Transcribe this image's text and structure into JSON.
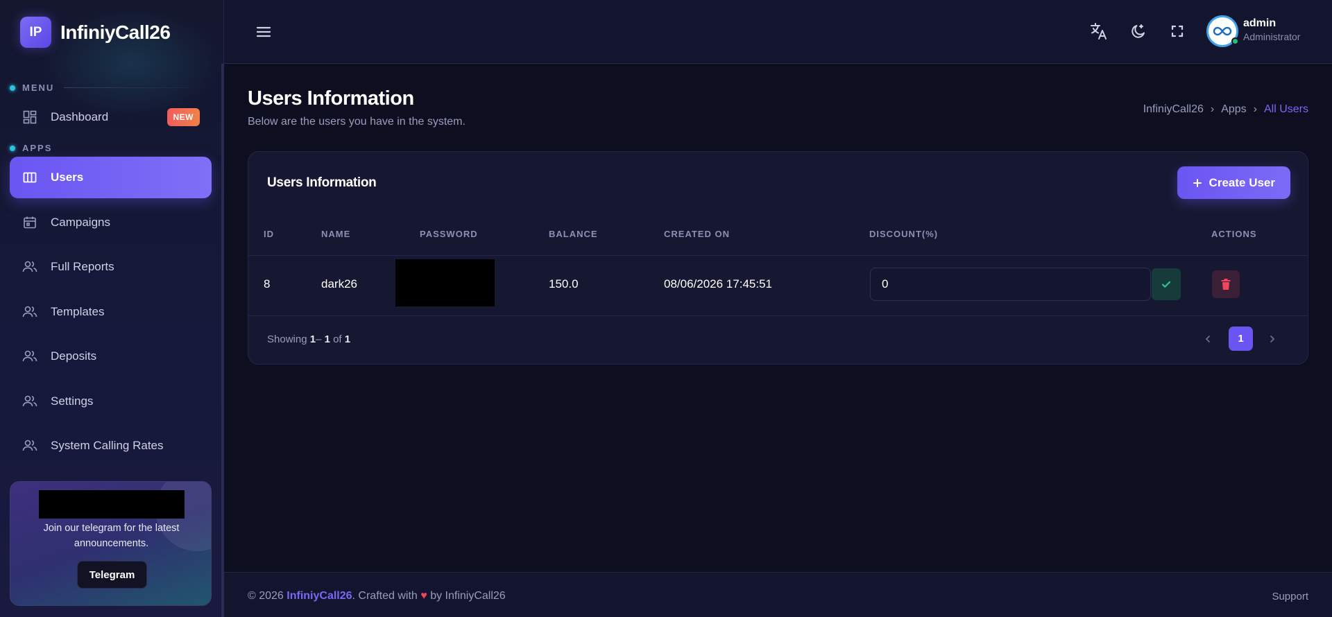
{
  "brand": {
    "logo_text": "IP",
    "name": "InfiniyCall26"
  },
  "sidebar": {
    "sections": [
      {
        "label": "MENU"
      },
      {
        "label": "APPS"
      }
    ],
    "items": [
      {
        "label": "Dashboard",
        "icon": "dashboard-icon",
        "badge": "NEW"
      },
      {
        "label": "Users",
        "icon": "table-icon",
        "active": true
      },
      {
        "label": "Campaigns",
        "icon": "calendar-icon"
      },
      {
        "label": "Full Reports",
        "icon": "users-icon"
      },
      {
        "label": "Templates",
        "icon": "users-icon"
      },
      {
        "label": "Deposits",
        "icon": "users-icon"
      },
      {
        "label": "Settings",
        "icon": "users-icon"
      },
      {
        "label": "System Calling Rates",
        "icon": "users-icon"
      }
    ],
    "promo": {
      "text": "Join our telegram for the latest announcements.",
      "button_label": "Telegram"
    }
  },
  "topbar": {
    "icons": [
      "menu-icon",
      "translate-icon",
      "moon-icon",
      "fullscreen-icon"
    ],
    "user": {
      "name": "admin",
      "role": "Administrator"
    }
  },
  "page": {
    "title": "Users Information",
    "subtitle": "Below are the users you have in the system.",
    "breadcrumb": [
      "InfiniyCall26",
      "Apps",
      "All Users"
    ]
  },
  "card": {
    "title": "Users Information",
    "create_button": "Create User",
    "columns": [
      "ID",
      "NAME",
      "PASSWORD",
      "BALANCE",
      "CREATED ON",
      "DISCOUNT(%)",
      "ACTIONS"
    ],
    "rows": [
      {
        "id": "8",
        "name": "dark26",
        "balance": "150.0",
        "created_on": "08/06/2026 17:45:51",
        "discount": "0"
      }
    ],
    "showing": {
      "prefix": "Showing",
      "from": "1",
      "dash": "–",
      "to": "1",
      "of_word": "of",
      "total": "1"
    },
    "current_page": "1"
  },
  "footer": {
    "copyright": "© 2026",
    "brand": "InfiniyCall26",
    "crafted": ". Crafted with",
    "heart": "♥",
    "by": "by InfiniyCall26",
    "support": "Support"
  },
  "colors": {
    "accent": "#6a55f2",
    "badge": "#f25c5c",
    "success": "#21c17a",
    "danger": "#f0455a"
  }
}
